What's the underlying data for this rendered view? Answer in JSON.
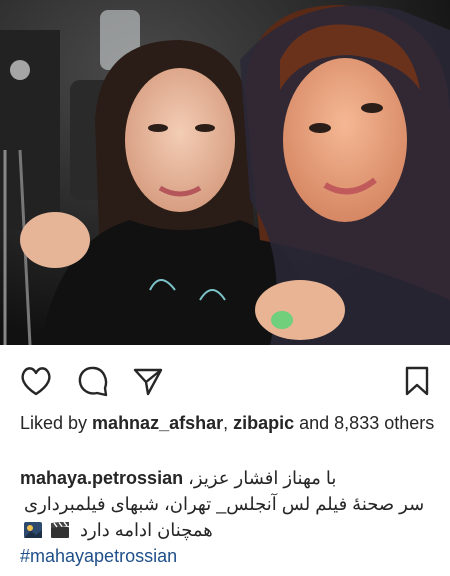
{
  "post": {
    "photo": {
      "alt_icon": "photo-image"
    },
    "actions": {
      "like_icon": "heart-icon",
      "comment_icon": "comment-icon",
      "share_icon": "share-icon",
      "save_icon": "bookmark-icon"
    },
    "likes": {
      "prefix": "Liked by ",
      "user1": "mahnaz_afshar",
      "separator": ", ",
      "user2": "zibapic",
      "suffix": " and 8,833 others"
    },
    "caption": {
      "username": "mahaya.petrossian",
      "line1_text": "با مهناز افشار عزیز،",
      "line2_text": "سر صحنهٔ فیلم لس آنجلس_ تهران، شبهای فیلمبرداری",
      "line3_text": "همچنان ادامه دارد",
      "hashtag": "#mahayapetrossian"
    }
  },
  "colors": {
    "text": "#262626",
    "hashtag": "#1f4f8a",
    "background": "#ffffff"
  }
}
